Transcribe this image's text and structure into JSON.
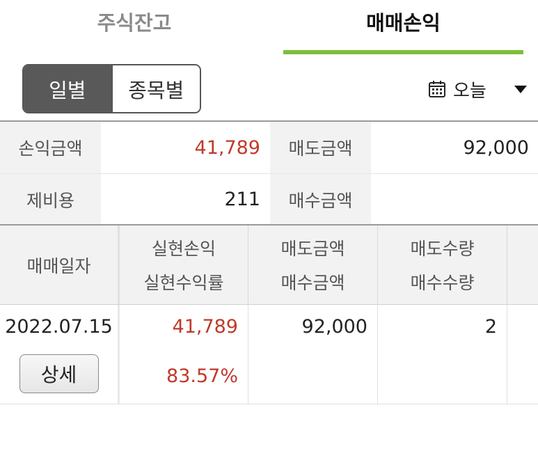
{
  "tabs": {
    "stock_balance": "주식잔고",
    "trade_pnl": "매매손익"
  },
  "segment": {
    "daily": "일별",
    "by_stock": "종목별"
  },
  "date_selector": {
    "label": "오늘",
    "icon": "calendar-icon"
  },
  "summary": {
    "pnl_amount_label": "손익금액",
    "pnl_amount_value": "41,789",
    "sell_amount_label": "매도금액",
    "sell_amount_value": "92,000",
    "fees_label": "제비용",
    "fees_value": "211",
    "buy_amount_label": "매수금액",
    "buy_amount_value": ""
  },
  "detail_table": {
    "headers": {
      "trade_date": "매매일자",
      "realized_pnl": "실현손익",
      "realized_return": "실현수익률",
      "sell_amount": "매도금액",
      "buy_amount": "매수금액",
      "sell_qty": "매도수량",
      "buy_qty": "매수수량"
    },
    "rows": [
      {
        "trade_date": "2022.07.15",
        "detail_button": "상세",
        "realized_pnl": "41,789",
        "realized_return": "83.57%",
        "sell_amount": "92,000",
        "buy_amount": "",
        "sell_qty": "2",
        "buy_qty": ""
      }
    ]
  },
  "colors": {
    "accent_green": "#7cbf3a",
    "profit_red": "#c0392b",
    "segment_active": "#595959"
  }
}
